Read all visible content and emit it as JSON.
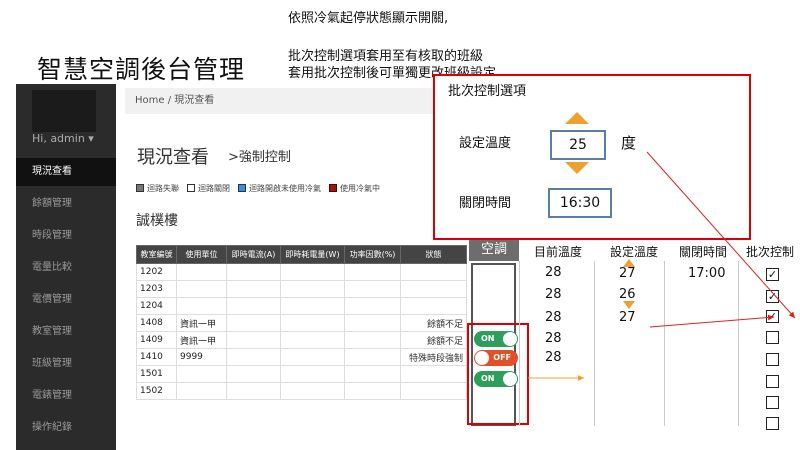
{
  "notes": {
    "line1": "依照冷氣起停狀態顯示開關,",
    "line2": "批次控制選項套用至有核取的班級",
    "line3": "套用批次控制後可單獨更改班級設定"
  },
  "app_title": "智慧空調後台管理",
  "sidebar": {
    "user": "Hi, admin ▾",
    "items": [
      "現況查看",
      "餘額管理",
      "時段管理",
      "電量比較",
      "電價管理",
      "教室管理",
      "班級管理",
      "電錶管理",
      "操作紀錄"
    ]
  },
  "breadcrumb": {
    "home": "Home",
    "sep": "/",
    "current": "現況查看"
  },
  "page_title": "現況查看",
  "force_control": ">強制控制",
  "legend": [
    {
      "label": "迴路失聯",
      "color": "#777777"
    },
    {
      "label": "迴路關閉",
      "color": "#ffffff"
    },
    {
      "label": "迴路開啟未使用冷氣",
      "color": "#3a8fd8"
    },
    {
      "label": "使用冷氣中",
      "color": "#a01515"
    }
  ],
  "building": "誠樸樓",
  "table": {
    "headers": [
      "教室編號",
      "使用單位",
      "即時電流(A)",
      "即時耗電量(W)",
      "功率因數(%)",
      "狀態"
    ],
    "rows": [
      {
        "room": "1202",
        "unit": "",
        "status": ""
      },
      {
        "room": "1203",
        "unit": "",
        "status": ""
      },
      {
        "room": "1204",
        "unit": "",
        "status": ""
      },
      {
        "room": "1408",
        "unit": "資訊一甲",
        "status": "餘額不足"
      },
      {
        "room": "1409",
        "unit": "資訊一甲",
        "status": "餘額不足"
      },
      {
        "room": "1410",
        "unit": "9999",
        "status": "特殊時段強制"
      },
      {
        "room": "1501",
        "unit": "",
        "status": ""
      },
      {
        "room": "1502",
        "unit": "",
        "status": ""
      }
    ]
  },
  "batch_panel": {
    "title": "批次控制選項",
    "temp_label": "設定溫度",
    "temp_value": "25",
    "temp_unit": "度",
    "close_label": "關閉時間",
    "close_value": "16:30"
  },
  "extra_headers": {
    "ac": "空調",
    "current_temp": "目前溫度",
    "set_temp": "設定溫度",
    "close_time": "關閉時間",
    "batch": "批次控制"
  },
  "extra_rows": [
    {
      "current": "28",
      "set": "27",
      "close": "17:00",
      "checked": true,
      "toggle": null
    },
    {
      "current": "28",
      "set": "26",
      "close": "",
      "checked": true,
      "toggle": null
    },
    {
      "current": "28",
      "set": "27",
      "close": "",
      "checked": true,
      "toggle": null
    },
    {
      "current": "28",
      "set": "",
      "close": "",
      "checked": false,
      "toggle": "ON"
    },
    {
      "current": "28",
      "set": "",
      "close": "",
      "checked": false,
      "toggle": "OFF"
    },
    {
      "current": "",
      "set": "",
      "close": "",
      "checked": false,
      "toggle": "ON"
    },
    {
      "current": "",
      "set": "",
      "close": "",
      "checked": false,
      "toggle": null
    },
    {
      "current": "",
      "set": "",
      "close": "",
      "checked": false,
      "toggle": null
    }
  ],
  "colors": {
    "on": "#2e9e5b",
    "off": "#e2502a",
    "accent_red": "#dd0000",
    "arrow": "#f0a030"
  }
}
